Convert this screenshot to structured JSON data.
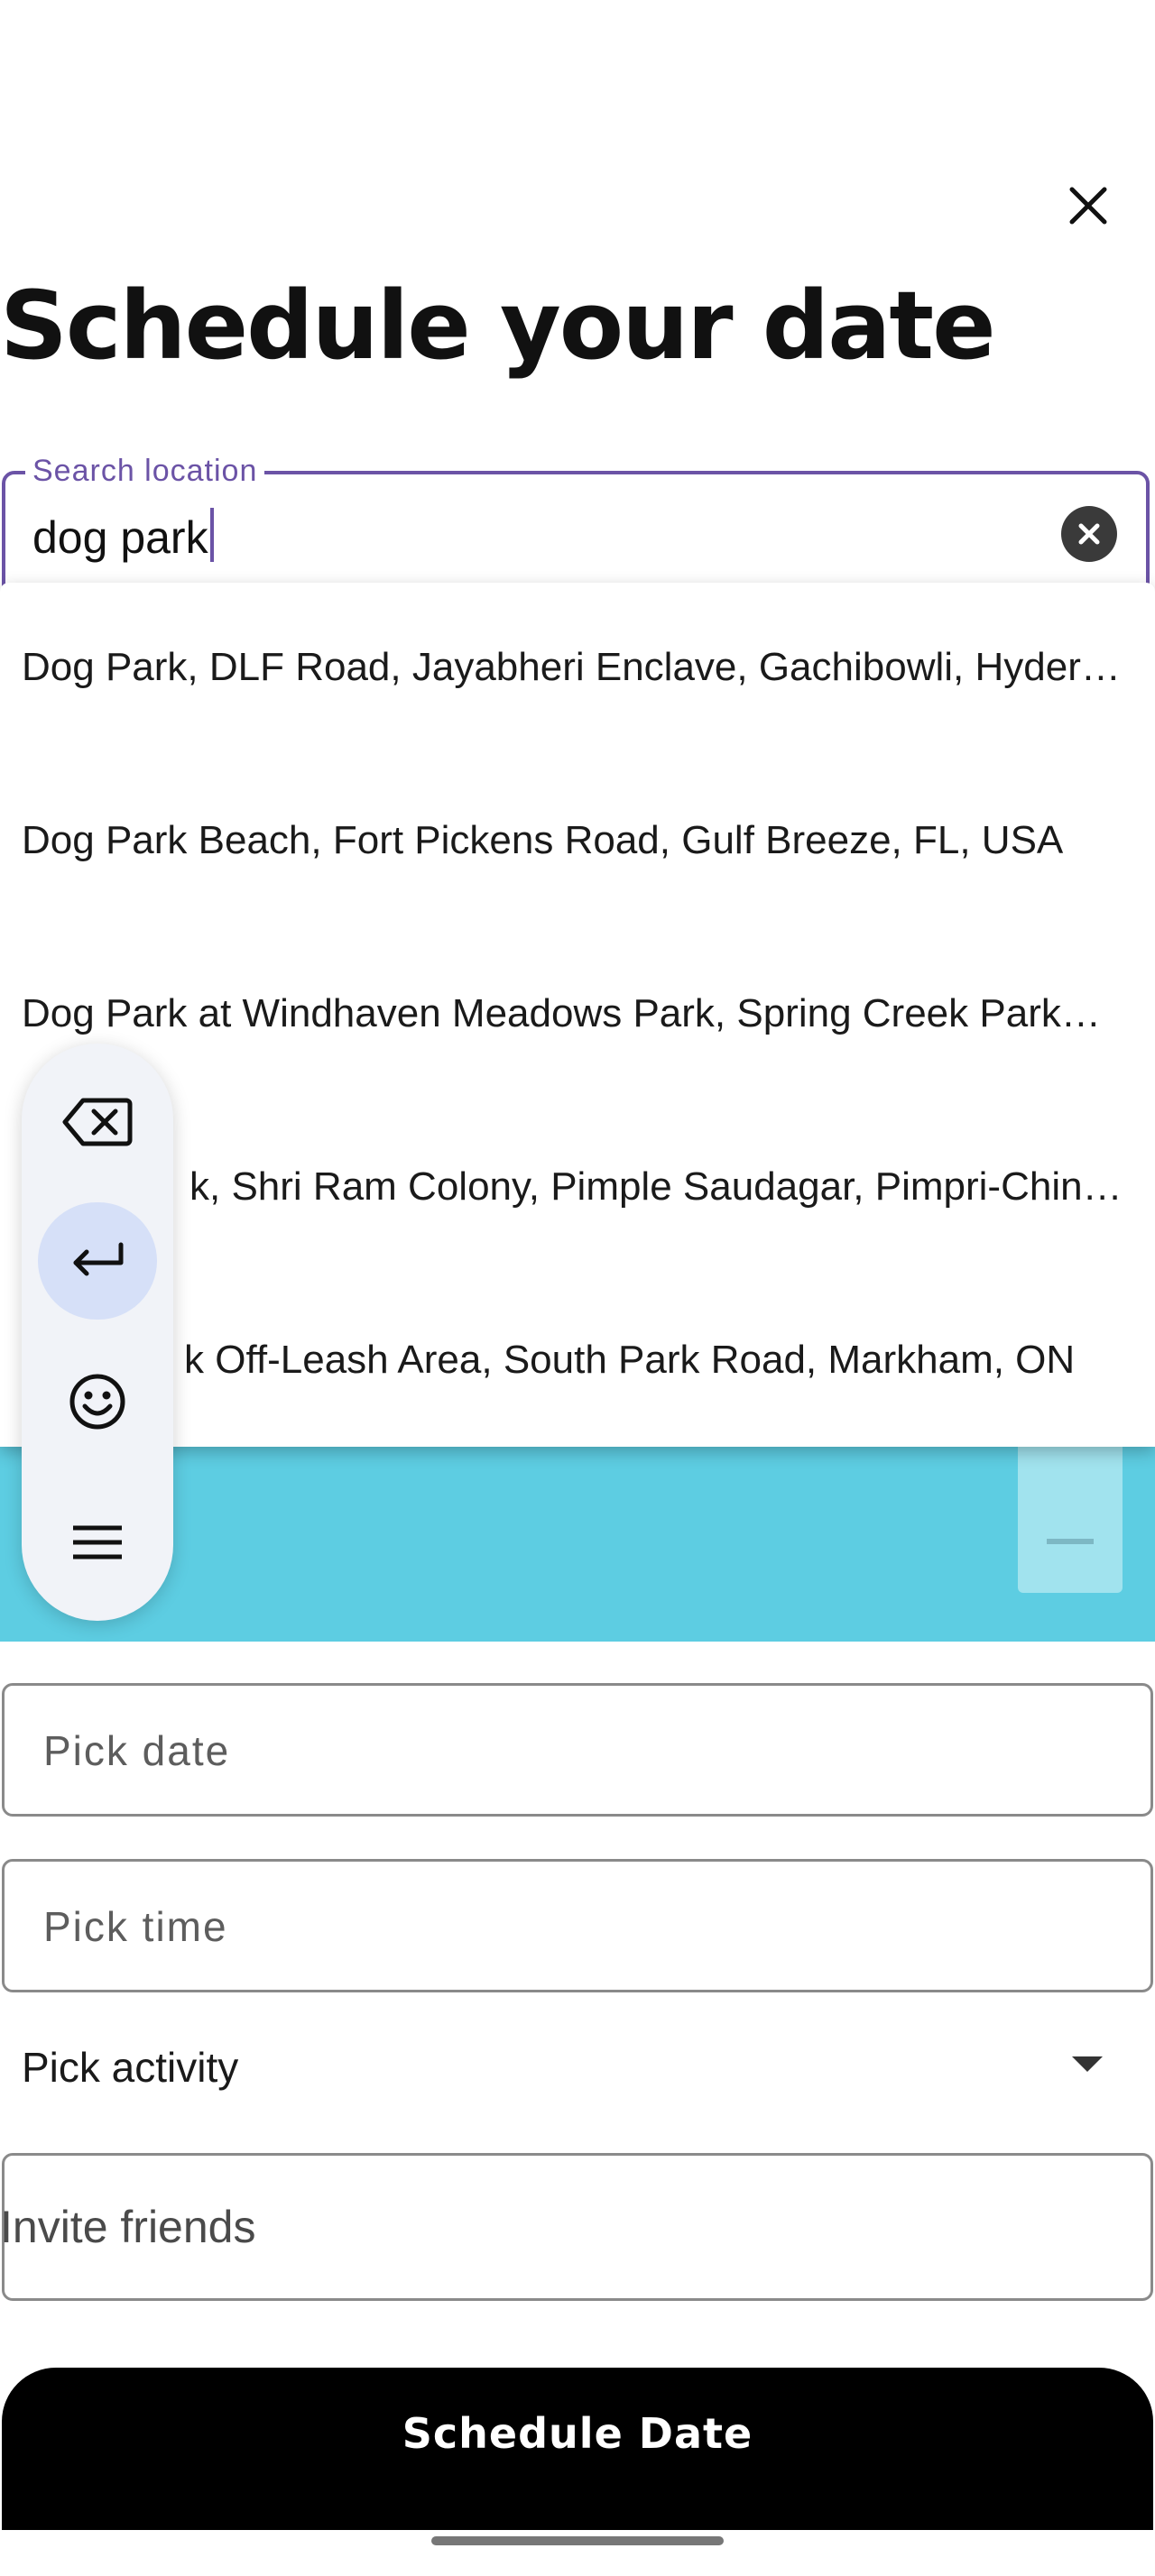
{
  "dialog": {
    "title": "Schedule your date"
  },
  "search": {
    "label": "Search location",
    "value": "dog park"
  },
  "suggestions": [
    {
      "label": "Dog Park, DLF Road, Jayabheri Enclave, Gachibowli, Hyderabad, Telangana, India"
    },
    {
      "label": "Dog Park Beach, Fort Pickens Road, Gulf Breeze, FL, USA"
    },
    {
      "label": "Dog Park at Windhaven Meadows Park, Spring Creek Parkway"
    },
    {
      "label": "k, Shri Ram Colony, Pimple Saudagar, Pimpri-Chinchwad"
    },
    {
      "label": "k Off-Leash Area, South Park Road, Markham, ON"
    }
  ],
  "form": {
    "date_placeholder": "Pick date",
    "time_placeholder": "Pick time",
    "activity_label": "Pick activity",
    "invite_placeholder": "Invite friends",
    "submit_label": "Schedule Date"
  },
  "keyboard_toolbar": {
    "buttons": [
      "backspace-icon",
      "enter-icon",
      "emoji-icon",
      "menu-icon"
    ]
  },
  "colors": {
    "accent": "#6b53a6",
    "map_water": "#5dcde2",
    "button_bg": "#000000"
  }
}
